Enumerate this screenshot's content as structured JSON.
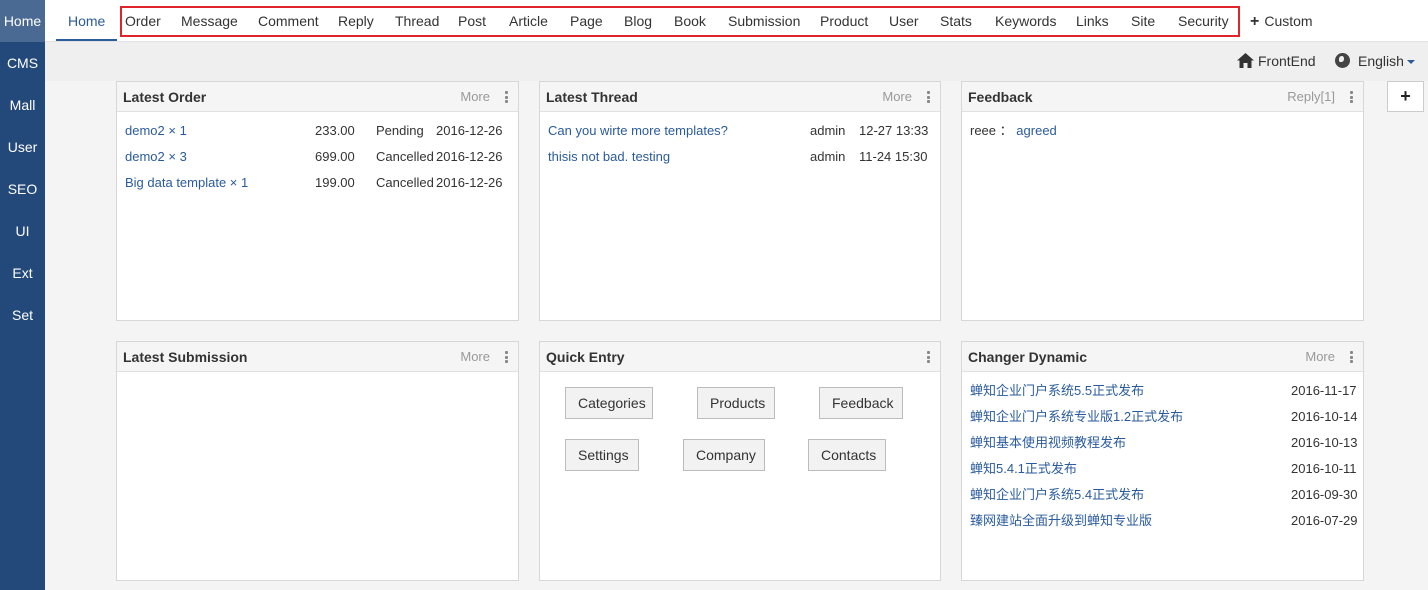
{
  "sidebar": {
    "items": [
      {
        "label": "Home"
      },
      {
        "label": "CMS"
      },
      {
        "label": "Mall"
      },
      {
        "label": "User"
      },
      {
        "label": "SEO"
      },
      {
        "label": "UI"
      },
      {
        "label": "Ext"
      },
      {
        "label": "Set"
      }
    ]
  },
  "topnav": {
    "home": "Home",
    "tabs": [
      "Order",
      "Message",
      "Comment",
      "Reply",
      "Thread",
      "Post",
      "Article",
      "Page",
      "Blog",
      "Book",
      "Submission",
      "Product",
      "User",
      "Stats",
      "Keywords",
      "Links",
      "Site",
      "Security"
    ],
    "custom": "Custom",
    "highlight_color": "#e0242b"
  },
  "subbar": {
    "frontend": "FrontEnd",
    "language": "English"
  },
  "add_button": "+",
  "panels": {
    "latest_order": {
      "title": "Latest Order",
      "more": "More",
      "rows": [
        {
          "name": "demo2 × 1",
          "amount": "233.00",
          "status": "Pending",
          "date": "2016-12-26"
        },
        {
          "name": "demo2 × 3",
          "amount": "699.00",
          "status": "Cancelled",
          "date": "2016-12-26"
        },
        {
          "name": "Big data template × 1",
          "amount": "199.00",
          "status": "Cancelled",
          "date": "2016-12-26"
        }
      ]
    },
    "latest_thread": {
      "title": "Latest Thread",
      "more": "More",
      "rows": [
        {
          "subject": "Can you wirte more templates?",
          "author": "admin",
          "time": "12-27 13:33"
        },
        {
          "subject": "thisis not bad. testing",
          "author": "admin",
          "time": "11-24 15:30"
        }
      ]
    },
    "feedback": {
      "title": "Feedback",
      "more": "Reply[1]",
      "rows": [
        {
          "user": "reee",
          "sep": "：",
          "text": "agreed"
        }
      ]
    },
    "latest_submission": {
      "title": "Latest Submission",
      "more": "More"
    },
    "quick_entry": {
      "title": "Quick Entry",
      "buttons": [
        "Categories",
        "Products",
        "Feedback",
        "Settings",
        "Company",
        "Contacts"
      ]
    },
    "changer_dynamic": {
      "title": "Changer Dynamic",
      "more": "More",
      "rows": [
        {
          "title": "蝉知企业门户系统5.5正式发布",
          "date": "2016-11-17"
        },
        {
          "title": "蝉知企业门户系统专业版1.2正式发布",
          "date": "2016-10-14"
        },
        {
          "title": "蝉知基本使用视频教程发布",
          "date": "2016-10-13"
        },
        {
          "title": "蝉知5.4.1正式发布",
          "date": "2016-10-11"
        },
        {
          "title": "蝉知企业门户系统5.4正式发布",
          "date": "2016-09-30"
        },
        {
          "title": "臻网建站全面升级到蝉知专业版",
          "date": "2016-07-29"
        }
      ]
    }
  }
}
